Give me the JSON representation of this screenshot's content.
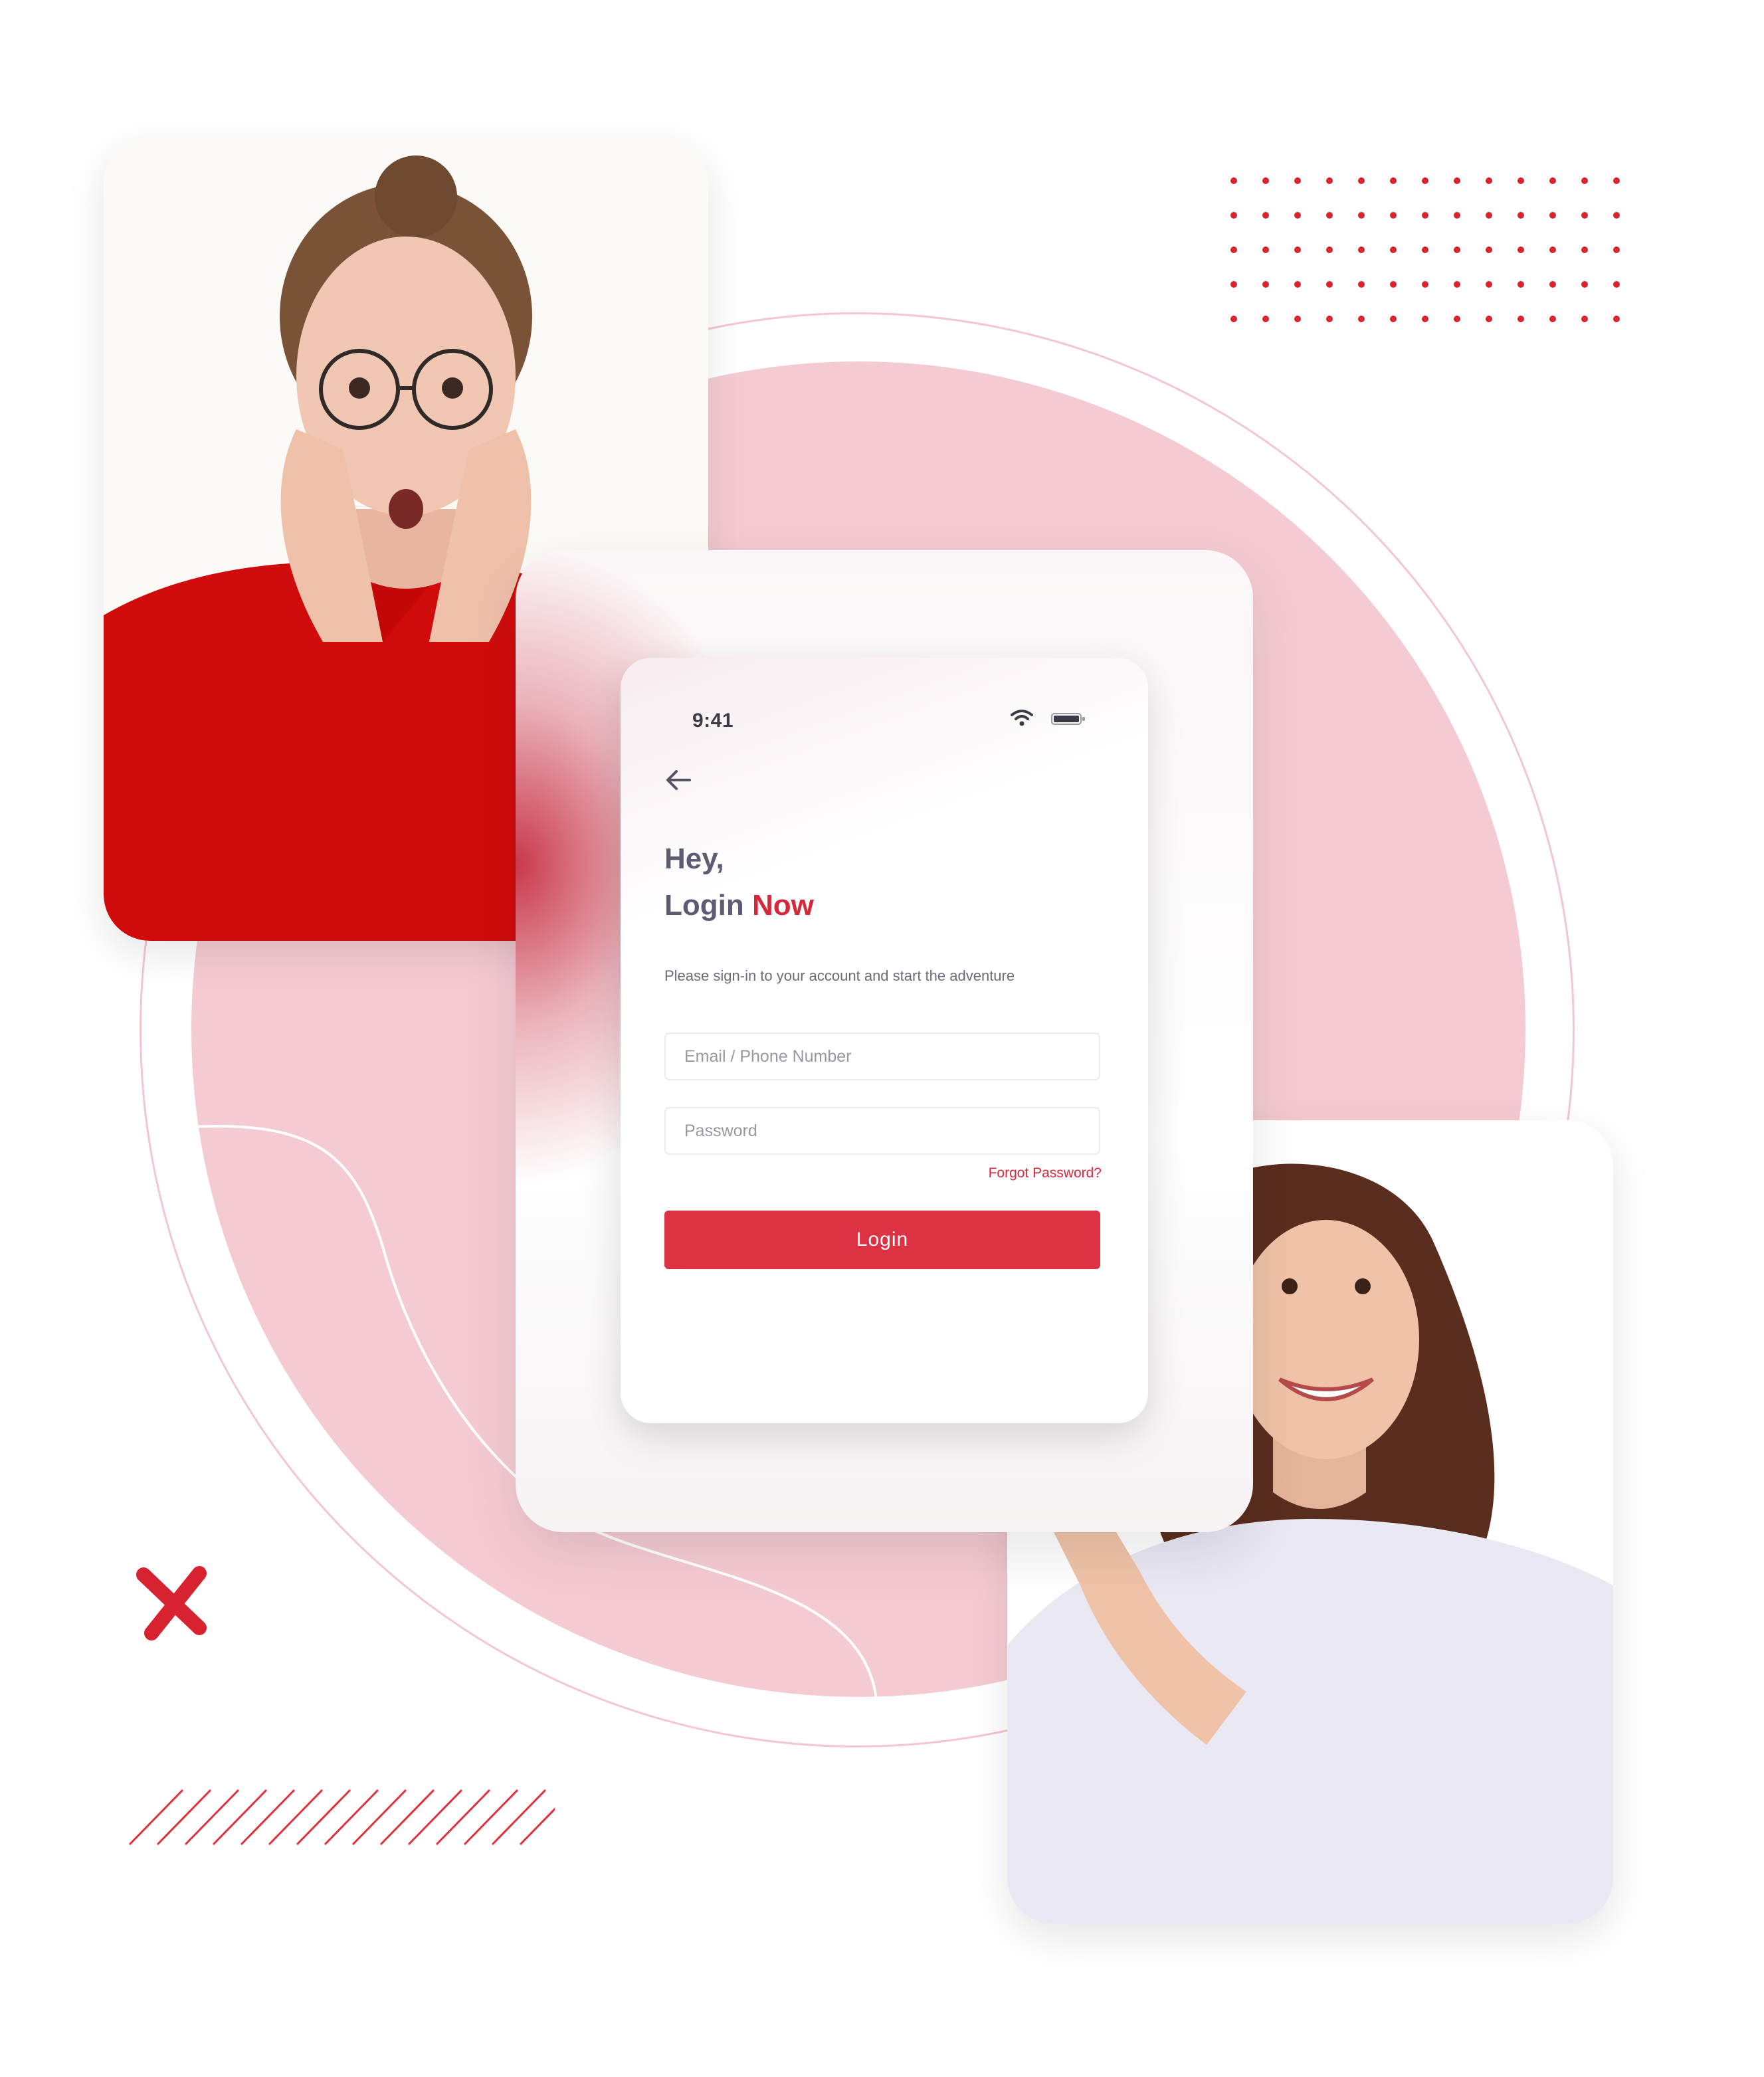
{
  "images": {
    "left_photo": "surprised woman with glasses and hands on cheeks, red sweater",
    "right_photo": "smiling woman pointing, white t-shirt"
  },
  "login_screen": {
    "status_bar": {
      "time": "9:41",
      "wifi_icon": "wifi-icon",
      "battery_icon": "battery-icon"
    },
    "back_icon": "arrow-left-icon",
    "greeting_line1": "Hey,",
    "greeting_line2_prefix": "Login",
    "greeting_line2_accent": "Now",
    "subtitle": "Please sign-in to your account and start the adventure",
    "email_placeholder": "Email / Phone Number",
    "password_placeholder": "Password",
    "forgot_password": "Forgot Password?",
    "login_button": "Login"
  },
  "colors": {
    "accent": "#d5283a",
    "button": "#dd3244",
    "heading": "#5e5b73",
    "background_circle": "#f5cbd3"
  }
}
